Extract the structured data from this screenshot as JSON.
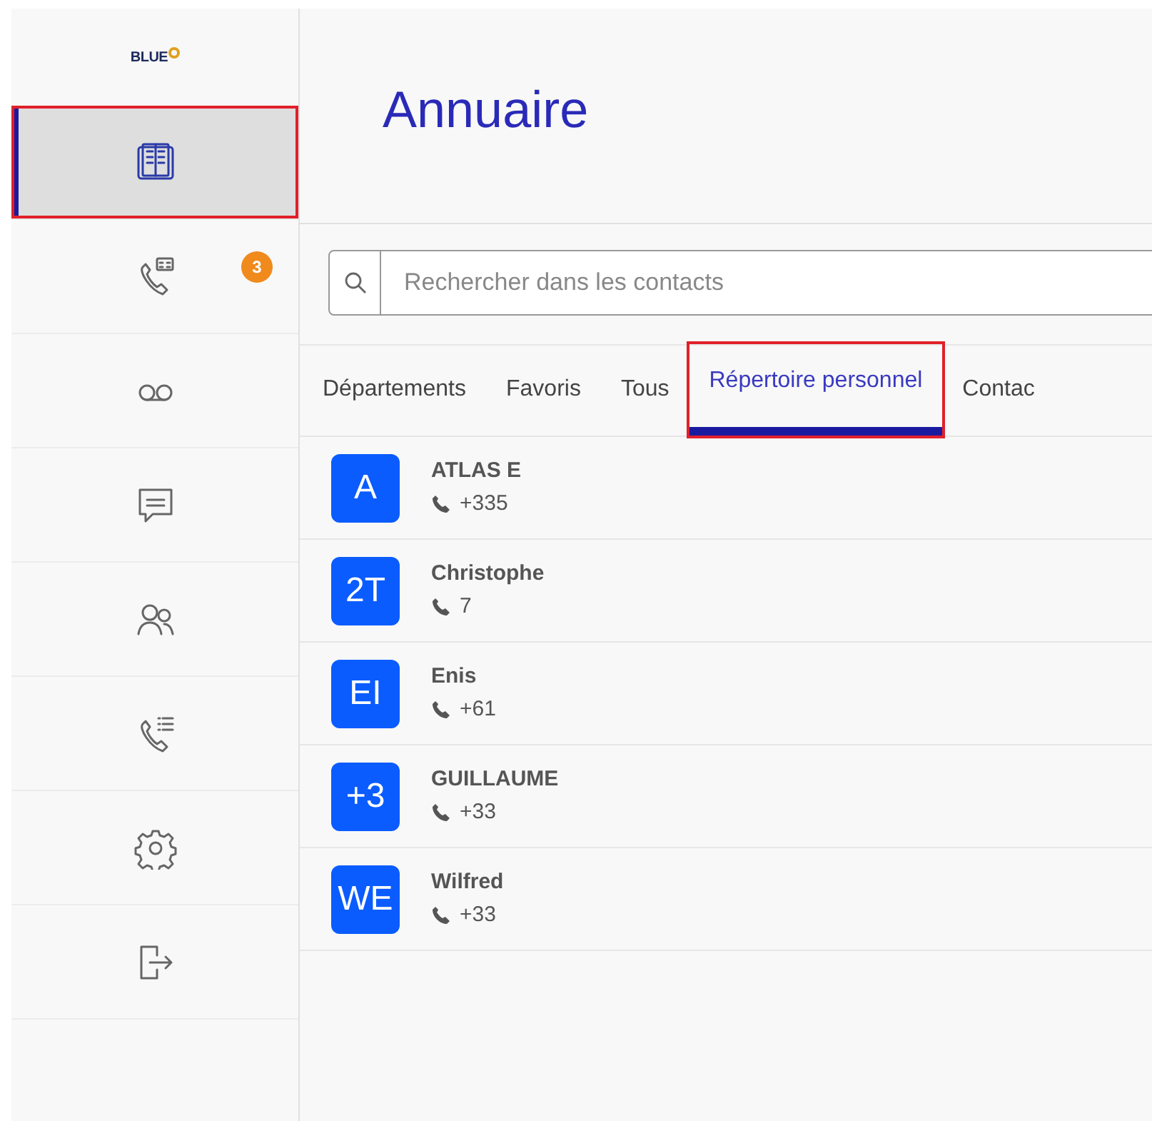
{
  "logo": {
    "text": "BLUE"
  },
  "sidebar": {
    "items": [
      {
        "kind": "directory",
        "selected": true,
        "highlighted": true
      },
      {
        "kind": "call-log",
        "selected": false,
        "highlighted": false,
        "badge": "3"
      },
      {
        "kind": "voicemail",
        "selected": false,
        "highlighted": false
      },
      {
        "kind": "messages",
        "selected": false,
        "highlighted": false
      },
      {
        "kind": "contacts",
        "selected": false,
        "highlighted": false
      },
      {
        "kind": "call-list",
        "selected": false,
        "highlighted": false
      },
      {
        "kind": "settings",
        "selected": false,
        "highlighted": false
      },
      {
        "kind": "logout",
        "selected": false,
        "highlighted": false
      }
    ]
  },
  "page_title": "Annuaire",
  "search": {
    "placeholder": "Rechercher dans les contacts"
  },
  "tabs": [
    {
      "label": "Départements",
      "selected": false,
      "highlighted": false
    },
    {
      "label": "Favoris",
      "selected": false,
      "highlighted": false
    },
    {
      "label": "Tous",
      "selected": false,
      "highlighted": false
    },
    {
      "label": "Répertoire personnel",
      "selected": true,
      "highlighted": true
    },
    {
      "label": "Contac",
      "selected": false,
      "highlighted": false
    }
  ],
  "contacts": [
    {
      "initials": "A",
      "name": "ATLAS E",
      "phone": "+335"
    },
    {
      "initials": "2T",
      "name": "Christophe",
      "phone": "7"
    },
    {
      "initials": "EI",
      "name": "Enis",
      "phone": "+61"
    },
    {
      "initials": "+3",
      "name": "GUILLAUME",
      "phone": "+33"
    },
    {
      "initials": "WE",
      "name": "Wilfred",
      "phone": "+33"
    }
  ]
}
